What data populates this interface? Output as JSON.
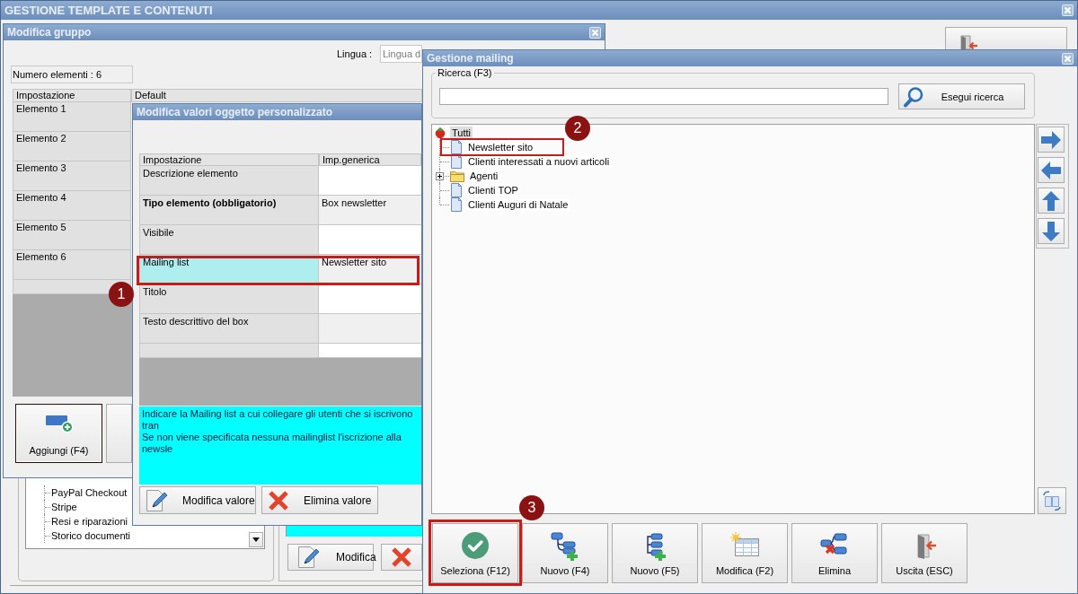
{
  "main_window": {
    "title": "GESTIONE TEMPLATE E CONTENUTI",
    "top_buttons": [
      {
        "kind": "exit"
      }
    ],
    "tree_items": [
      "PayPal Checkout",
      "Stripe",
      "Resi e riparazioni",
      "Storico documenti"
    ],
    "buttons": [
      {
        "label": "Modifica",
        "kind": "edit"
      },
      {
        "kind": "delete"
      }
    ]
  },
  "group_window": {
    "title": "Modifica gruppo",
    "language": {
      "label": "Lingua :",
      "value": "Lingua d"
    },
    "count": "Numero elementi : 6",
    "columns": [
      "Impostazione",
      "Default"
    ],
    "rows": [
      "Elemento 1",
      "Elemento 2",
      "Elemento 3",
      "Elemento 4",
      "Elemento 5",
      "Elemento 6"
    ],
    "buttons": [
      {
        "label": "Aggiungi (F4)",
        "kind": "add",
        "focused": true
      },
      {
        "kind": "other",
        "focused": false
      }
    ]
  },
  "values_window": {
    "title": "Modifica valori oggetto personalizzato",
    "columns": [
      "Impostazione",
      "Imp.generica"
    ],
    "rows": [
      {
        "setting": "Descrizione elemento",
        "required": false,
        "selected": false
      },
      {
        "setting": "Tipo elemento (obbligatorio)",
        "value": "Box newsletter",
        "required": true,
        "selected": false
      },
      {
        "setting": "Visibile",
        "required": false,
        "selected": false
      },
      {
        "setting": "Mailing list",
        "value": "Newsletter sito",
        "required": false,
        "selected": true,
        "callout": "1"
      },
      {
        "setting": "Titolo",
        "required": false,
        "selected": false
      },
      {
        "setting": "Testo descrittivo del box",
        "required": false,
        "selected": false
      },
      {
        "selected": false
      }
    ],
    "hint": [
      "Indicare la Mailing list a cui collegare gli utenti che si iscrivono tran",
      "Se non viene specificata nessuna mailinglist l'iscrizione alla newsle"
    ],
    "buttons": [
      {
        "label": "Modifica valore",
        "kind": "edit"
      },
      {
        "label": "Elimina valore",
        "kind": "delete"
      }
    ]
  },
  "mailing_window": {
    "title": "Gestione mailing",
    "search": {
      "legend": "Ricerca (F3)",
      "button": "Esegui ricerca"
    },
    "tree": [
      {
        "label": "Tutti",
        "kind": "root",
        "selected": true,
        "children": [
          {
            "label": "Newsletter sito",
            "kind": "list",
            "selected": false,
            "callout": "2"
          },
          {
            "label": "Clienti interessati a nuovi articoli",
            "kind": "list",
            "selected": false
          },
          {
            "label": "Agenti",
            "kind": "folder",
            "selected": false,
            "expanded": false
          },
          {
            "label": "Clienti TOP",
            "kind": "list",
            "selected": false
          },
          {
            "label": "Clienti Auguri di Natale",
            "kind": "list",
            "selected": false
          }
        ]
      }
    ],
    "side_buttons": [
      {
        "kind": "right"
      },
      {
        "kind": "left"
      },
      {
        "kind": "up"
      },
      {
        "kind": "down"
      },
      {
        "kind": "refresh"
      }
    ],
    "buttons": [
      {
        "label": "Seleziona (F12)",
        "kind": "select",
        "callout": "3"
      },
      {
        "label": "Nuovo (F4)",
        "kind": "new-branch"
      },
      {
        "label": "Nuovo (F5)",
        "kind": "new-list"
      },
      {
        "label": "Modifica (F2)",
        "kind": "edit"
      },
      {
        "label": "Elimina",
        "kind": "delete"
      },
      {
        "label": "Uscita (ESC)",
        "kind": "exit"
      }
    ]
  }
}
